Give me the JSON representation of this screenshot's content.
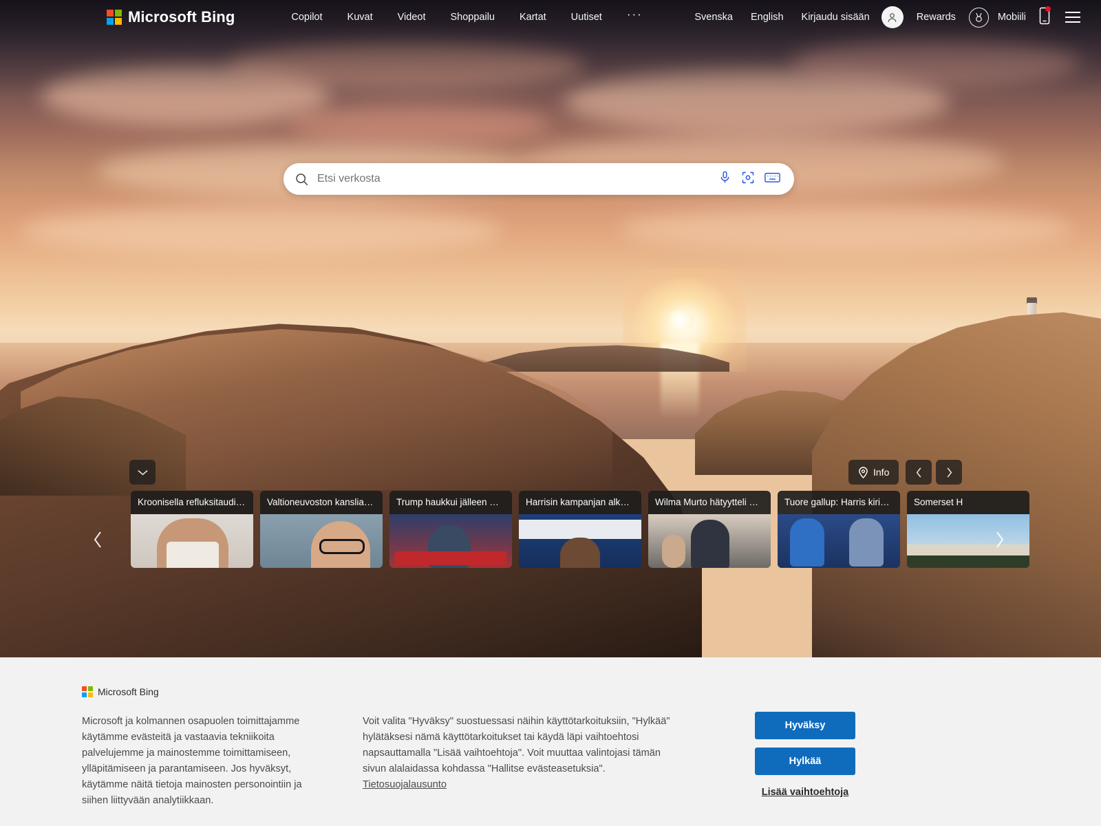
{
  "header": {
    "brand": "Microsoft Bing",
    "nav": [
      {
        "label": "Copilot"
      },
      {
        "label": "Kuvat"
      },
      {
        "label": "Videot"
      },
      {
        "label": "Shoppailu"
      },
      {
        "label": "Kartat"
      },
      {
        "label": "Uutiset"
      }
    ],
    "more_label": "···",
    "right": {
      "lang_sv": "Svenska",
      "lang_en": "English",
      "sign_in": "Kirjaudu sisään",
      "rewards": "Rewards",
      "mobile": "Mobiili"
    }
  },
  "search": {
    "value": "",
    "placeholder": "Etsi verkosta",
    "icons": {
      "search": "search-icon",
      "voice": "microphone-icon",
      "visual": "visual-search-icon",
      "keyboard": "keyboard-icon"
    }
  },
  "hero": {
    "info_label": "Info",
    "expand_icon": "chevron-down-icon",
    "prev_icon": "chevron-left-icon",
    "next_icon": "chevron-right-icon"
  },
  "news": {
    "prev_arrow": "chevron-left-icon",
    "next_arrow": "chevron-right-icon",
    "cards": [
      {
        "title": "Kroonisella refluksitaudilla…",
        "art": "img-a"
      },
      {
        "title": "Valtioneuvoston kanslia sa…",
        "art": "img-b"
      },
      {
        "title": "Trump haukkui jälleen Har…",
        "art": "img-c"
      },
      {
        "title": "Harrisin kampanjan alku o…",
        "art": "img-d"
      },
      {
        "title": "Wilma Murto hätyytteli M…",
        "art": "img-e"
      },
      {
        "title": "Tuore gallup: Harris kirinyt…",
        "art": "img-f"
      },
      {
        "title": "Somerset H",
        "art": "img-g"
      }
    ]
  },
  "cookie": {
    "brand": "Microsoft Bing",
    "paragraph1": "Microsoft ja kolmannen osapuolen toimittajamme käytämme evästeitä ja vastaavia tekniikoita palvelujemme ja mainostemme toimittamiseen, ylläpitämiseen ja parantamiseen. Jos hyväksyt, käytämme näitä tietoja mainosten personointiin ja siihen liittyvään analytiikkaan.",
    "paragraph2": "Voit valita \"Hyväksy\" suostuessasi näihin käyttötarkoituksiin, \"Hylkää\" hylätäksesi nämä käyttötarkoitukset tai käydä läpi vaihtoehtosi napsauttamalla \"Lisää vaihtoehtoja\". Voit muuttaa valintojasi tämän sivun alalaidassa kohdassa \"Hallitse evästeasetuksia\".  ",
    "privacy_link": "Tietosuojalausunto",
    "accept": "Hyväksy",
    "reject": "Hylkää",
    "more_options": "Lisää vaihtoehtoja"
  },
  "colors": {
    "accent_blue": "#0f6cbd",
    "ms_red": "#f25022",
    "ms_green": "#7fba00",
    "ms_blue": "#00a4ef",
    "ms_yellow": "#ffb900",
    "notification_red": "#e81123"
  }
}
